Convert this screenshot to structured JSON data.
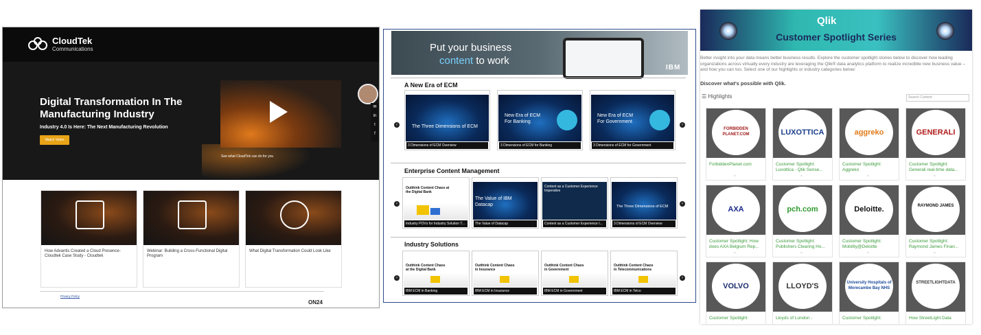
{
  "cloudtek": {
    "brand_name": "CloudTek",
    "brand_sub": "Communications",
    "hero_title": "Digital Transformation In The Manufacturing Industry",
    "hero_subtitle": "Industry 4.0 Is Here: The Next Manufacturing Revolution",
    "watch_button": "Watch Video",
    "video_caption": "See what CloudTek can do for you",
    "social": [
      "✉",
      "in",
      "t",
      "f"
    ],
    "cards": [
      {
        "title": "How Advantis Created a Cloud Presence- Cloudtek Case Study - Cloudtek",
        "icon": "document-magnifier-icon"
      },
      {
        "title": "Webinar: Building a Cross-Functional Digital Program",
        "icon": "monitor-user-icon"
      },
      {
        "title": "What Digital Transformation Could Look Like",
        "icon": "play-circle-icon"
      }
    ],
    "privacy": "Privacy Policy",
    "footer_logo": "ON24"
  },
  "ibm": {
    "banner_line1": "Put your business",
    "banner_line2_a": "content",
    "banner_line2_b": " to work",
    "banner_logo": "IBM",
    "sections": [
      {
        "title": "A New Era of ECM",
        "tiles": [
          {
            "text": "The Three Dimensions of ECM",
            "caption": "3 Dimensions of ECM Overview"
          },
          {
            "text": "New Era of ECM For Banking",
            "caption": "3 Dimensions of ECM for Banking"
          },
          {
            "text": "New Era of ECM For Government",
            "caption": "3 Dimensions of ECM for Government"
          }
        ]
      },
      {
        "title": "Enterprise Content Management",
        "tiles": [
          {
            "text": "Outthink Content Chaos at the Digital Bank",
            "caption": "Industry POVs for Industry Solution T..."
          },
          {
            "text": "The Value of IBM Datacap",
            "caption": "The Value of Datacap"
          },
          {
            "text": "Content as a Customer Experience Imperative",
            "caption": "Content as a Customer Experience I..."
          },
          {
            "text": "The Three Dimensions of ECM",
            "caption": "3 Dimensions of ECM Overview"
          }
        ]
      },
      {
        "title": "Industry Solutions",
        "tiles": [
          {
            "text": "Outthink Content Chaos at the Digital Bank",
            "caption": "IBM ECM in Banking"
          },
          {
            "text": "Outthink Content Chaos in Insurance",
            "caption": "IBM ECM in Insurance"
          },
          {
            "text": "Outthink Content Chaos in Government",
            "caption": "IBM ECM in Government"
          },
          {
            "text": "Outthink Content Chaos in Telecommunications",
            "caption": "IBM ECM in Telco"
          }
        ]
      }
    ]
  },
  "qlik": {
    "logo": "Qlik",
    "series_title": "Customer Spotlight Series",
    "intro": "Better insight into your data means better business results.  Explore the customer spotlight stories below to discover how leading organizations across virtually every industry are leveraging the Qlik® data analytics platform to realize incredible new business value – and how you can too.  Select one of our highlights or industry categories below:",
    "discover": "Discover what's possible with Qlik.",
    "highlights": "Highlights",
    "search_placeholder": "Search Content",
    "cards": [
      {
        "logo": "FORBIDDEN PLANET.COM",
        "title": "ForbiddenPlanet.com",
        "color": "#a01818"
      },
      {
        "logo": "LUXOTTICA",
        "title": "Customer Spotlight: Luxottica - Qlik Sense...",
        "color": "#1a3c8a"
      },
      {
        "logo": "aggreko",
        "title": "Customer Spotlight: Aggreko",
        "color": "#e07a1a"
      },
      {
        "logo": "GENERALI",
        "title": "Customer Spotlight: Generali real-time data...",
        "color": "#b01a1a"
      },
      {
        "logo": "AXA",
        "title": "Customer Spotlight: How does AXA Belgium Rep...",
        "color": "#1a2a8a"
      },
      {
        "logo": "pch.com",
        "title": "Customer Spotlight: Publishers Clearing Ho...",
        "color": "#2f9a2f"
      },
      {
        "logo": "Deloitte.",
        "title": "Customer Spotlight: Mobility@Deloitte",
        "color": "#111111"
      },
      {
        "logo": "RAYMOND JAMES",
        "title": "Customer Spotlight: Raymond James Finan...",
        "color": "#111111"
      },
      {
        "logo": "VOLVO",
        "title": "Customer Spotlight:",
        "color": "#1a2a6a"
      },
      {
        "logo": "LLOYD'S",
        "title": "Lloyds of London -",
        "color": "#333333"
      },
      {
        "logo": "University Hospitals of Morecambe Bay NHS",
        "title": "Customer Spotlight:",
        "color": "#1a4a9a"
      },
      {
        "logo": "STREETLIGHTDATA",
        "title": "How StreetLight Data",
        "color": "#333333"
      }
    ]
  }
}
